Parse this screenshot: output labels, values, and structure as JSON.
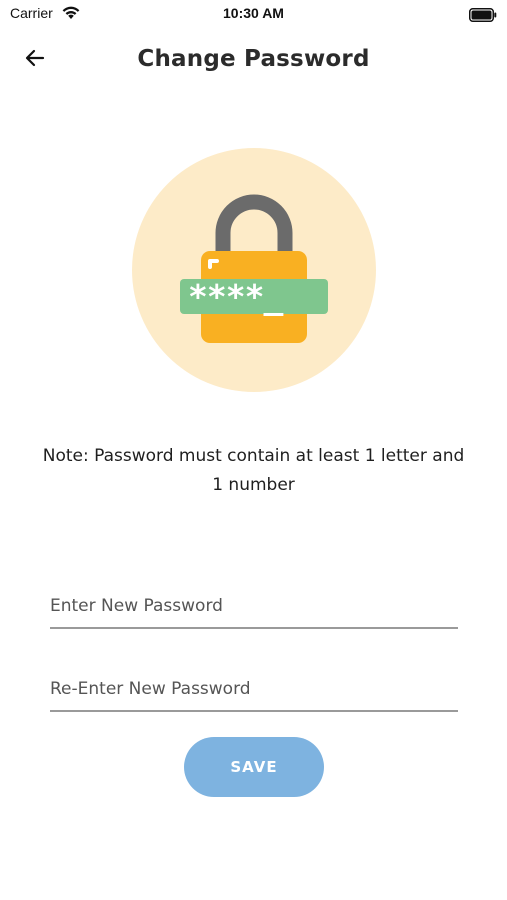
{
  "status_bar": {
    "carrier": "Carrier",
    "time": "10:30 AM",
    "wifi_icon": "wifi-icon",
    "battery_icon": "battery-icon"
  },
  "header": {
    "title": "Change Password",
    "back_icon": "arrow-left-icon"
  },
  "illustration": {
    "icon": "password-lock-illustration",
    "masked_text": "****_",
    "colors": {
      "circle": "#fdebc8",
      "lock_body": "#f9b022",
      "shackle": "#6b6b6b",
      "password_bar": "#7fc68e"
    }
  },
  "note": {
    "text": "Note: Password must contain at least 1 letter and 1 number"
  },
  "form": {
    "new_password_placeholder": "Enter New Password",
    "new_password_value": "",
    "confirm_password_placeholder": "Re-Enter New Password",
    "confirm_password_value": ""
  },
  "save_button": {
    "label": "SAVE",
    "color": "#7eb3e0"
  }
}
